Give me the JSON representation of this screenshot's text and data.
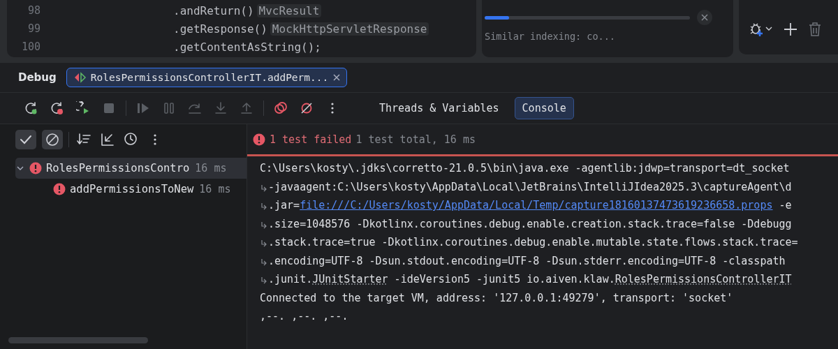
{
  "editor": {
    "lines": [
      {
        "number": "98",
        "code": ".andReturn()",
        "hint": "MvcResult"
      },
      {
        "number": "99",
        "code": ".getResponse()",
        "hint": "MockHttpServletResponse"
      },
      {
        "number": "100",
        "code": ".getContentAsString();"
      }
    ]
  },
  "notification": {
    "level": 0.12,
    "text": "Similar indexing: co..."
  },
  "debug": {
    "title": "Debug",
    "session_tab": {
      "label": "RolesPermissionsControllerIT.addPerm...",
      "selected": true
    },
    "toolbar": [
      {
        "kind": "rerun-debug",
        "disabled": false
      },
      {
        "kind": "rerun-failed",
        "disabled": false
      },
      {
        "kind": "rerun-run",
        "disabled": false
      },
      {
        "kind": "stop",
        "disabled": true
      },
      {
        "kind": "sep"
      },
      {
        "kind": "resume",
        "disabled": true
      },
      {
        "kind": "pause",
        "disabled": true
      },
      {
        "kind": "step-over",
        "disabled": true
      },
      {
        "kind": "step-into",
        "disabled": true
      },
      {
        "kind": "step-out",
        "disabled": true
      },
      {
        "kind": "sep"
      },
      {
        "kind": "breakpoints",
        "disabled": false
      },
      {
        "kind": "mute",
        "disabled": false
      },
      {
        "kind": "more",
        "disabled": false
      }
    ],
    "view_tabs": [
      {
        "label": "Threads & Variables",
        "selected": false
      },
      {
        "label": "Console",
        "selected": true
      }
    ]
  },
  "tests": {
    "toolbar": [
      {
        "kind": "check",
        "on": true
      },
      {
        "kind": "ignored",
        "on": true
      },
      {
        "kind": "sep"
      },
      {
        "kind": "sort"
      },
      {
        "kind": "collapse"
      },
      {
        "kind": "clock"
      },
      {
        "kind": "more"
      }
    ],
    "tree": [
      {
        "label": "RolesPermissionsContro",
        "time": "16 ms",
        "failed": true,
        "expanded": true,
        "selected": true,
        "children": [
          {
            "label": "addPermissionsToNew",
            "time": "16 ms",
            "failed": true,
            "selected": false
          }
        ]
      }
    ]
  },
  "console": {
    "status": {
      "failed": "1 test failed",
      "total": "1 test total, 16 ms"
    },
    "lines": [
      {
        "kind": "plain",
        "parts": [
          {
            "kind": "text",
            "text": "C:\\Users\\kosty\\.jdks\\corretto-21.0.5\\bin\\java.exe -agentlib:jdwp=transport=dt_socket"
          }
        ]
      },
      {
        "kind": "wrapped",
        "parts": [
          {
            "kind": "text",
            "text": "-javaagent:C:\\Users\\kosty\\AppData\\Local\\JetBrains\\IntelliJIdea2025.3\\captureAgent\\d"
          }
        ]
      },
      {
        "kind": "wrapped",
        "parts": [
          {
            "kind": "text",
            "text": ".jar="
          },
          {
            "kind": "link",
            "text": "file:///C:/Users/kosty/AppData/Local/Temp/capture18160137473619236658.props"
          },
          {
            "kind": "text",
            "text": " -e"
          }
        ]
      },
      {
        "kind": "wrapped",
        "parts": [
          {
            "kind": "text",
            "text": ".size=1048576 -Dkotlinx.coroutines.debug.enable.creation.stack.trace=false -Ddebugg"
          }
        ]
      },
      {
        "kind": "wrapped",
        "parts": [
          {
            "kind": "text",
            "text": ".stack.trace=true -Dkotlinx.coroutines.debug.enable.mutable.state.flows.stack.trace="
          }
        ]
      },
      {
        "kind": "wrapped",
        "parts": [
          {
            "kind": "text",
            "text": ".encoding=UTF-8 -Dsun.stdout.encoding=UTF-8 -Dsun.stderr.encoding=UTF-8 -classpath"
          }
        ]
      },
      {
        "kind": "wrapped",
        "parts": [
          {
            "kind": "text",
            "text": ".junit."
          },
          {
            "kind": "ref",
            "text": "JUnitStarter"
          },
          {
            "kind": "text",
            "text": " -ideVersion5 -junit5 io.aiven.klaw."
          },
          {
            "kind": "ref",
            "text": "RolesPermissionsControllerIT"
          }
        ]
      },
      {
        "kind": "plain",
        "parts": [
          {
            "kind": "text",
            "text": "Connected to the target VM, address: '127.0.0.1:49279', transport: 'socket'"
          }
        ]
      },
      {
        "kind": "plain",
        "parts": [
          {
            "kind": "text",
            "text": ",--. ,--. ,--."
          }
        ]
      }
    ]
  }
}
